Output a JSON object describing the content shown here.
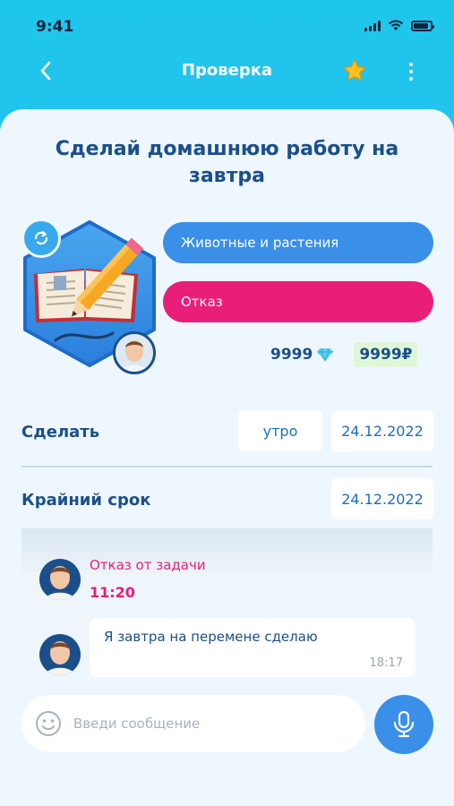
{
  "status_bar": {
    "time": "9:41",
    "icons": [
      "cellular-signal-icon",
      "wifi-icon",
      "battery-icon"
    ]
  },
  "nav": {
    "title": "Проверка",
    "back_icon": "chevron-left-icon",
    "star_icon": "star-icon",
    "more_icon": "more-vertical-icon"
  },
  "task": {
    "title": "Сделай домашнюю работу на завтра",
    "image_icon": "book-pencil-icon",
    "refresh_icon": "repeat-icon",
    "category": "Животные и растения",
    "status": "Отказ",
    "gems": "9999",
    "gem_icon": "diamond-icon",
    "money": "9999₽"
  },
  "schedule": {
    "do_label": "Сделать",
    "do_time": "утро",
    "do_date": "24.12.2022",
    "deadline_label": "Крайний срок",
    "deadline_date": "24.12.2022"
  },
  "chat": {
    "system_message": "Отказ от задачи",
    "system_time": "11:20",
    "messages": [
      {
        "text": "Я завтра на перемене сделаю",
        "time": "18:17"
      }
    ]
  },
  "composer": {
    "placeholder": "Введи сообщение",
    "emoji_icon": "smiley-icon",
    "mic_icon": "microphone-icon"
  },
  "colors": {
    "header": "#1fc6ec",
    "primary": "#3a8fe8",
    "danger": "#e91e7b",
    "text": "#1b4f8a",
    "money_bg": "#dff7d6"
  }
}
